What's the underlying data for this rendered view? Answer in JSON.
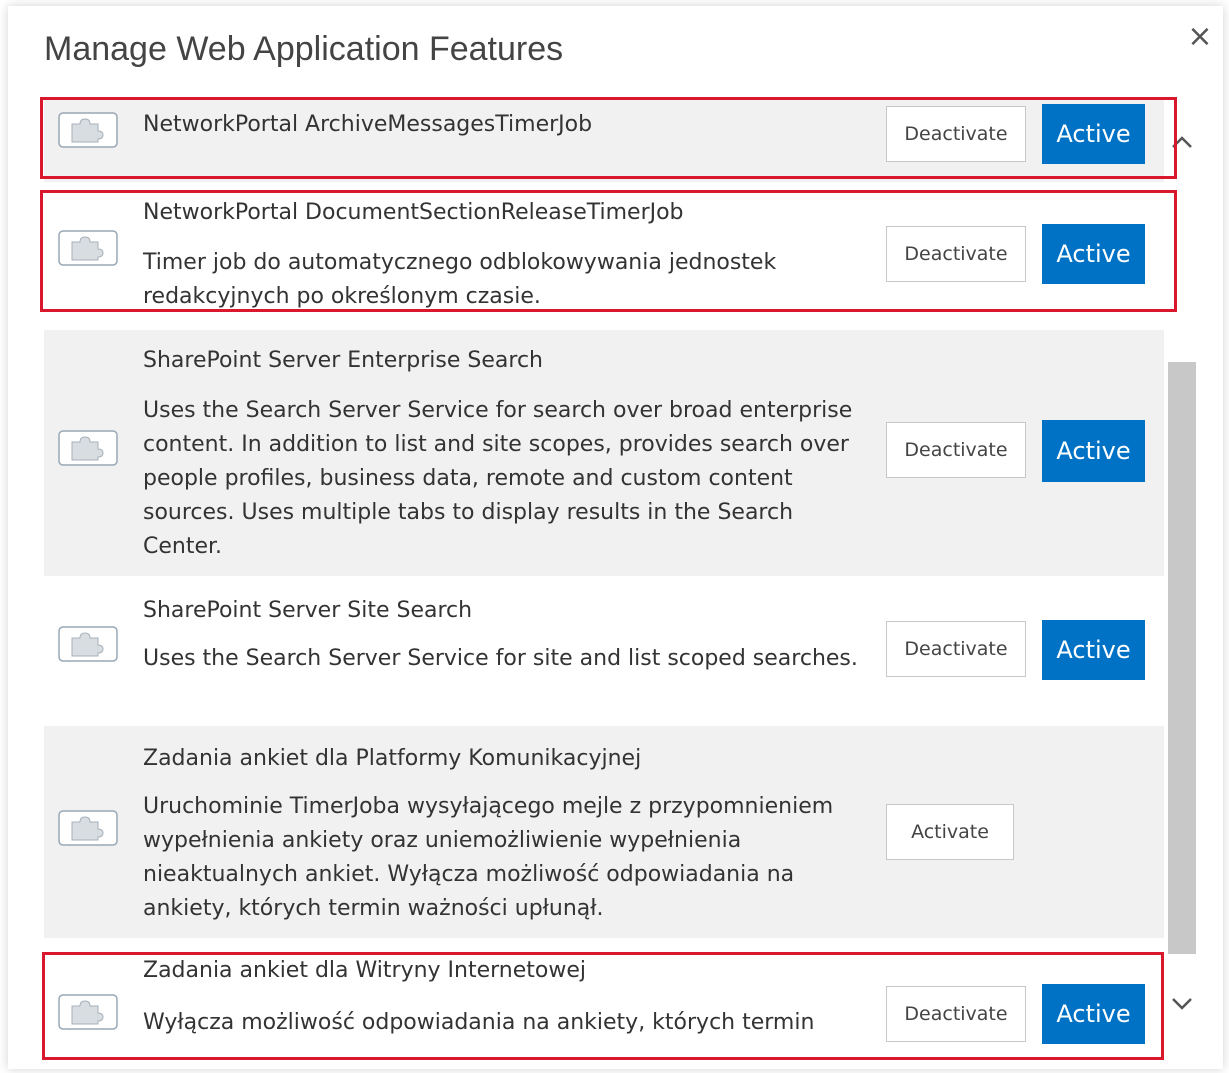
{
  "dialog": {
    "title": "Manage Web Application Features",
    "close_glyph": "×"
  },
  "features": [
    {
      "title": "NetworkPortal ArchiveMessagesTimerJob",
      "description": "",
      "button": "Deactivate",
      "status": "Active",
      "highlighted": true
    },
    {
      "title": "NetworkPortal DocumentSectionReleaseTimerJob",
      "description": "Timer job do automatycznego odblokowywania jednostek redakcyjnych po określonym czasie.",
      "button": "Deactivate",
      "status": "Active",
      "highlighted": true
    },
    {
      "title": "SharePoint Server Enterprise Search",
      "description": "Uses the Search Server Service for search over broad enterprise content. In addition to list and site scopes, provides search over people profiles, business data, remote and custom content sources. Uses multiple tabs to display results in the Search Center.",
      "button": "Deactivate",
      "status": "Active",
      "highlighted": false
    },
    {
      "title": "SharePoint Server Site Search",
      "description": "Uses the Search Server Service for site and list scoped searches.",
      "button": "Deactivate",
      "status": "Active",
      "highlighted": false
    },
    {
      "title": "Zadania ankiet dla Platformy Komunikacyjnej",
      "description": "Uruchominie TimerJoba wysyłającego mejle z przypomnieniem wypełnienia ankiety oraz uniemożliwienie wypełnienia nieaktualnych ankiet. Wyłącza możliwość odpowiadania na ankiety, których termin ważności upłunął.",
      "button": "Activate",
      "status": "",
      "highlighted": false
    },
    {
      "title": "Zadania ankiet dla Witryny Internetowej",
      "description": "Wyłącza możliwość odpowiadania na ankiety, których termin",
      "button": "Deactivate",
      "status": "Active",
      "highlighted": true
    }
  ],
  "icons": {
    "feature": "feature-puzzle-icon",
    "scroll_up": "chevron-up-icon",
    "scroll_down": "chevron-down-icon"
  },
  "colors": {
    "active_badge": "#0072c6",
    "highlight": "#d9182e",
    "row_gray": "#f1f1f1"
  }
}
